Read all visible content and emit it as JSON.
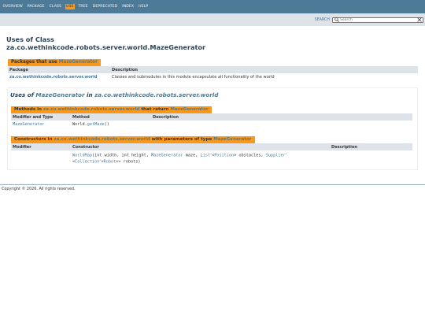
{
  "nav": {
    "items": [
      "OVERVIEW",
      "PACKAGE",
      "CLASS",
      "USE",
      "TREE",
      "DEPRECATED",
      "INDEX",
      "HELP"
    ],
    "active": "USE"
  },
  "search": {
    "label": "SEARCH",
    "placeholder": "Search"
  },
  "header": {
    "line1": "Uses of Class",
    "line2": "za.co.wethinkcode.robots.server.world.MazeGenerator"
  },
  "packages_caption": {
    "prefix": "Packages that use ",
    "link": "MazeGenerator"
  },
  "packages_table": {
    "headers": [
      "Package",
      "Description"
    ],
    "rows": [
      {
        "package": "za.co.wethinkcode.robots.server.world",
        "description": "Classes and submodules in this module encapsulate all functionality of the world"
      }
    ]
  },
  "uses_heading": {
    "prefix": "Uses of ",
    "class_link": "MazeGenerator",
    "middle": " in ",
    "package_link": "za.co.wethinkcode.robots.server.world"
  },
  "methods_caption": {
    "prefix": "Methods in ",
    "package_link": "za.co.wethinkcode.robots.server.world",
    "middle": " that return ",
    "class_link": "MazeGenerator"
  },
  "methods_table": {
    "headers": [
      "Modifier and Type",
      "Method",
      "Description"
    ],
    "row": {
      "type": "MazeGenerator",
      "owner": "World.",
      "method": "getMaze",
      "params": "()",
      "description": ""
    }
  },
  "constructors_caption": {
    "prefix": "Constructors in ",
    "package_link": "za.co.wethinkcode.robots.server.world",
    "middle": " with parameters of type ",
    "class_link": "MazeGenerator"
  },
  "constructors_table": {
    "headers": [
      "Modifier",
      "Constructor",
      "Description"
    ],
    "row": {
      "modifier": "",
      "name": "WorldMap",
      "p1": "(int width, int height, ",
      "p2": "MazeGenerator",
      "p3": " maze, ",
      "p4": "List",
      "p5": "<",
      "p6": "Position",
      "p7": "> obstacles, ",
      "p8": "Supplier",
      "p9": "<",
      "p10": "Collection",
      "p11": "<",
      "p12": "Robot",
      "p13": ">> robots)",
      "description": ""
    }
  },
  "footer": "Copyright © 2026. All rights reserved."
}
